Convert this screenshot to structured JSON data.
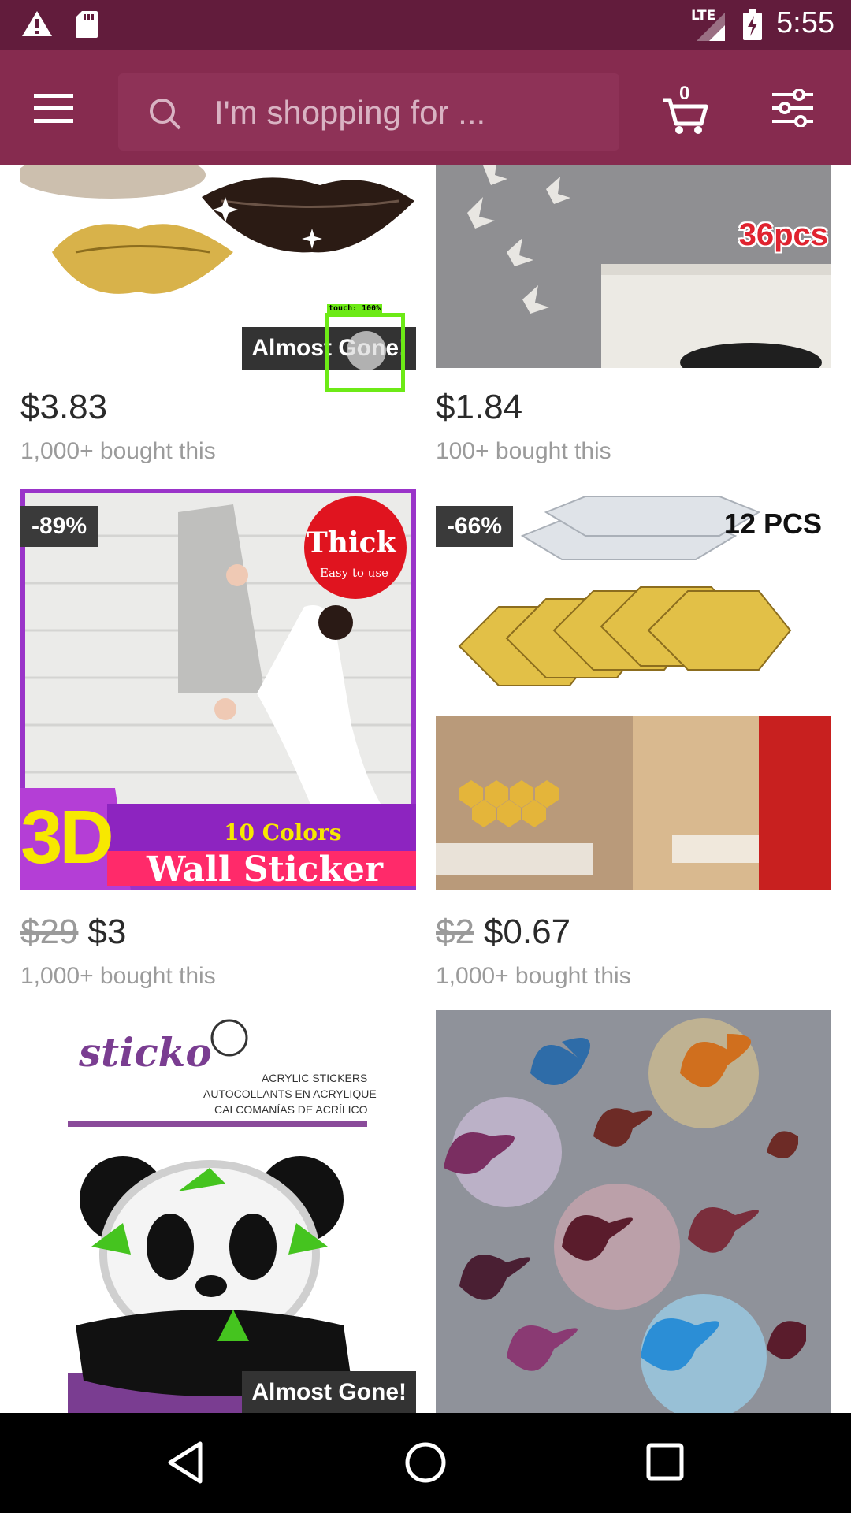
{
  "status_bar": {
    "network": "LTE",
    "time": "5:55"
  },
  "header": {
    "search_placeholder": "I'm shopping for ...",
    "cart_count": "0"
  },
  "products": [
    {
      "price": "$3.83",
      "bought": "1,000+ bought this",
      "badge": "Almost Gone!"
    },
    {
      "price": "$1.84",
      "bought": "100+ bought this",
      "image_text": "36pcs"
    },
    {
      "old_price": "$29",
      "price": "$3",
      "bought": "1,000+ bought this",
      "discount": "-89%",
      "image_text": {
        "thick": "Thick",
        "easy": "Easy to use",
        "colors": "10 Colors",
        "big": "3D",
        "sticker": "Wall Sticker"
      }
    },
    {
      "old_price": "$2",
      "price": "$0.67",
      "bought": "1,000+ bought this",
      "discount": "-66%",
      "image_text": "12 PCS"
    },
    {
      "badge": "Almost Gone!",
      "image_text": {
        "brand": "sticko",
        "line1": "ACRYLIC STICKERS",
        "line2": "AUTOCOLLANTS EN ACRYLIQUE",
        "line3": "CALCOMANÍAS DE ACRÍLICO"
      }
    },
    {}
  ],
  "touch_indicator": {
    "label": "touch: 100%"
  },
  "colors": {
    "status_bar": "#621c3c",
    "header": "#862b4f",
    "search_box": "#8e3257",
    "touch_box": "#6dea16"
  }
}
